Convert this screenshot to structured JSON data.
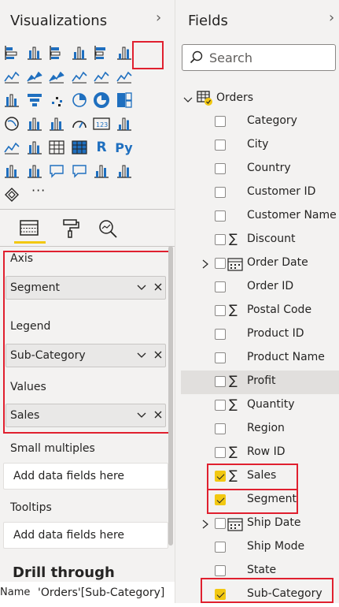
{
  "visualizations": {
    "title": "Visualizations",
    "more_label": "···",
    "icons": [
      "stacked-bar-icon",
      "stacked-column-icon",
      "clustered-bar-icon",
      "clustered-column-icon",
      "100-stacked-bar-icon",
      "100-stacked-column-icon",
      "line-chart-icon",
      "area-chart-icon",
      "stacked-area-icon",
      "line-clustered-column-icon",
      "line-stacked-column-icon",
      "ribbon-chart-icon",
      "waterfall-icon",
      "funnel-icon",
      "scatter-icon",
      "pie-chart-icon",
      "donut-chart-icon",
      "treemap-icon",
      "map-icon",
      "filled-map-icon",
      "shape-map-icon",
      "gauge-icon",
      "card-icon",
      "multi-row-card-icon",
      "kpi-icon",
      "slicer-icon",
      "table-icon",
      "matrix-icon",
      "r-visual-icon",
      "python-visual-icon",
      "key-influencers-icon",
      "decomposition-tree-icon",
      "qa-icon",
      "smart-narrative-icon",
      "paginated-report-icon",
      "power-apps-icon",
      "arcgis-icon"
    ],
    "wells": {
      "axis_label": "Axis",
      "axis_value": "Segment",
      "legend_label": "Legend",
      "legend_value": "Sub-Category",
      "values_label": "Values",
      "values_value": "Sales",
      "small_multiples_label": "Small multiples",
      "small_multiples_placeholder": "Add data fields here",
      "tooltips_label": "Tooltips",
      "tooltips_placeholder": "Add data fields here"
    },
    "drill_through_label": "Drill through",
    "drill_row_prefix": "Name",
    "drill_row_value": "'Orders'[Sub-Category]"
  },
  "fields": {
    "title": "Fields",
    "search_placeholder": "Search",
    "table_name": "Orders",
    "items": [
      {
        "label": "Category",
        "checked": false,
        "sigma": false,
        "date": false
      },
      {
        "label": "City",
        "checked": false,
        "sigma": false,
        "date": false
      },
      {
        "label": "Country",
        "checked": false,
        "sigma": false,
        "date": false
      },
      {
        "label": "Customer ID",
        "checked": false,
        "sigma": false,
        "date": false
      },
      {
        "label": "Customer Name",
        "checked": false,
        "sigma": false,
        "date": false
      },
      {
        "label": "Discount",
        "checked": false,
        "sigma": true,
        "date": false
      },
      {
        "label": "Order Date",
        "checked": false,
        "sigma": false,
        "date": true
      },
      {
        "label": "Order ID",
        "checked": false,
        "sigma": false,
        "date": false
      },
      {
        "label": "Postal Code",
        "checked": false,
        "sigma": true,
        "date": false
      },
      {
        "label": "Product ID",
        "checked": false,
        "sigma": false,
        "date": false
      },
      {
        "label": "Product Name",
        "checked": false,
        "sigma": false,
        "date": false
      },
      {
        "label": "Profit",
        "checked": false,
        "sigma": true,
        "date": false
      },
      {
        "label": "Quantity",
        "checked": false,
        "sigma": true,
        "date": false
      },
      {
        "label": "Region",
        "checked": false,
        "sigma": false,
        "date": false
      },
      {
        "label": "Row ID",
        "checked": false,
        "sigma": true,
        "date": false
      },
      {
        "label": "Sales",
        "checked": true,
        "sigma": true,
        "date": false
      },
      {
        "label": "Segment",
        "checked": true,
        "sigma": false,
        "date": false
      },
      {
        "label": "Ship Date",
        "checked": false,
        "sigma": false,
        "date": true
      },
      {
        "label": "Ship Mode",
        "checked": false,
        "sigma": false,
        "date": false
      },
      {
        "label": "State",
        "checked": false,
        "sigma": false,
        "date": false
      },
      {
        "label": "Sub-Category",
        "checked": true,
        "sigma": false,
        "date": false
      }
    ]
  },
  "colors": {
    "accent_yellow": "#f2c811",
    "highlight_red": "#e0202f",
    "icon_blue": "#1f6fbf",
    "pane_bg": "#f3f2f1"
  }
}
